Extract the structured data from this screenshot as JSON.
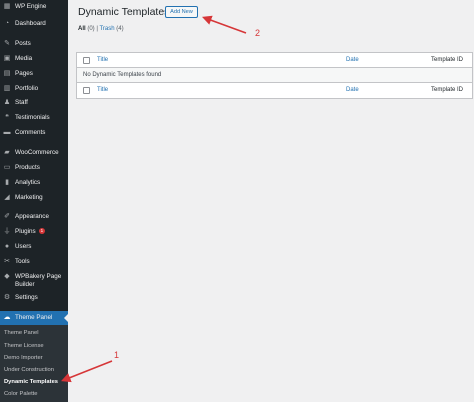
{
  "sidebar": {
    "items": [
      {
        "label": "WP Engine",
        "icon": "wp-engine-icon"
      },
      {
        "label": "Dashboard",
        "icon": "dashboard-icon"
      },
      {
        "label": "Posts",
        "icon": "pin-icon"
      },
      {
        "label": "Media",
        "icon": "media-icon"
      },
      {
        "label": "Pages",
        "icon": "page-icon"
      },
      {
        "label": "Portfolio",
        "icon": "portfolio-icon"
      },
      {
        "label": "Staff",
        "icon": "staff-icon"
      },
      {
        "label": "Testimonials",
        "icon": "testimonials-icon"
      },
      {
        "label": "Comments",
        "icon": "comment-icon"
      },
      {
        "label": "WooCommerce",
        "icon": "woocommerce-icon"
      },
      {
        "label": "Products",
        "icon": "products-icon"
      },
      {
        "label": "Analytics",
        "icon": "analytics-icon"
      },
      {
        "label": "Marketing",
        "icon": "megaphone-icon"
      },
      {
        "label": "Appearance",
        "icon": "brush-icon"
      },
      {
        "label": "Plugins",
        "icon": "plugin-icon",
        "badge": "1"
      },
      {
        "label": "Users",
        "icon": "users-icon"
      },
      {
        "label": "Tools",
        "icon": "wrench-icon"
      },
      {
        "label": "WPBakery Page Builder",
        "icon": "wpbakery-icon"
      },
      {
        "label": "Settings",
        "icon": "settings-icon"
      }
    ],
    "active": {
      "label": "Theme Panel",
      "icon": "theme-panel-icon"
    },
    "submenu": [
      "Theme Panel",
      "Theme License",
      "Demo Importer",
      "Under Construction",
      "Dynamic Templates",
      "Color Palette"
    ]
  },
  "page": {
    "title": "Dynamic Templates",
    "add_new": "Add New",
    "filters": {
      "all_label": "All",
      "all_count": "(0)",
      "separator": "|",
      "trash_label": "Trash",
      "trash_count": "(4)"
    }
  },
  "table": {
    "columns": [
      "Title",
      "Date",
      "Template ID"
    ],
    "empty_message": "No Dynamic Templates found"
  },
  "annotations": {
    "one": "1",
    "two": "2",
    "color": "#d63638"
  }
}
